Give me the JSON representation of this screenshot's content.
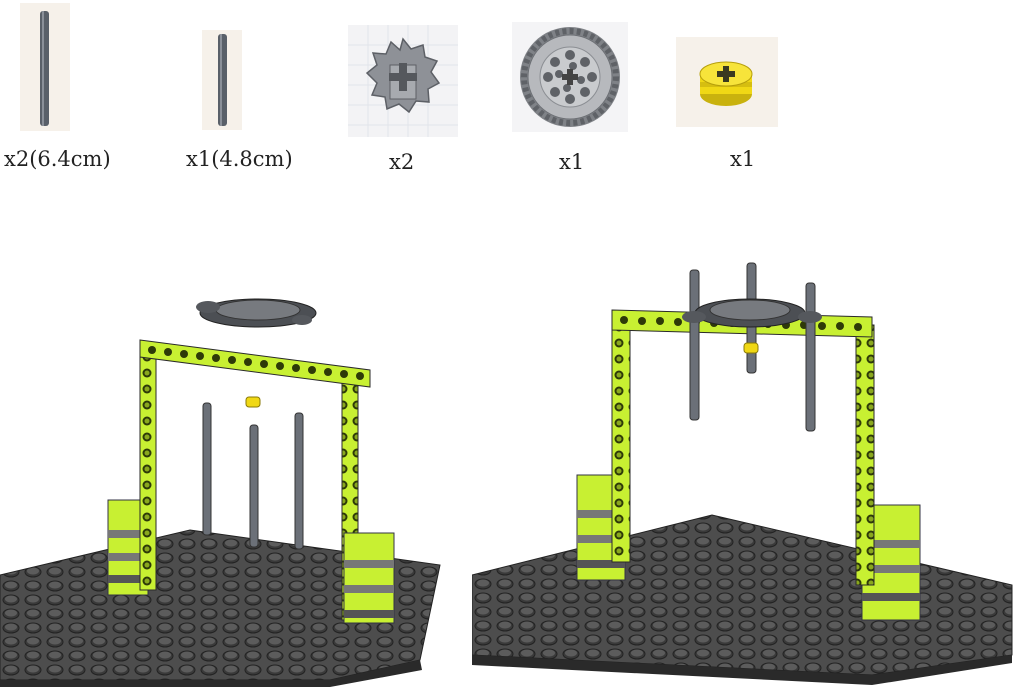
{
  "parts": [
    {
      "name": "axle-long",
      "quantity": "x2(6.4cm)"
    },
    {
      "name": "axle-short",
      "quantity": "x1(4.8cm)"
    },
    {
      "name": "small-gear-8-tooth",
      "quantity": "x2"
    },
    {
      "name": "large-gear-40-tooth",
      "quantity": "x1"
    },
    {
      "name": "bushing-yellow",
      "quantity": "x1"
    }
  ],
  "colors": {
    "beam_green": "#c8f032",
    "beam_dark": "#3b4a10",
    "brick_gray": "#6a6a6a",
    "baseplate": "#4a4a4a",
    "axle": "#5a6068",
    "gear": "#8a8d92",
    "bushing": "#f2dd1e"
  },
  "scenes": [
    {
      "name": "exploded-view"
    },
    {
      "name": "assembled-view"
    }
  ]
}
